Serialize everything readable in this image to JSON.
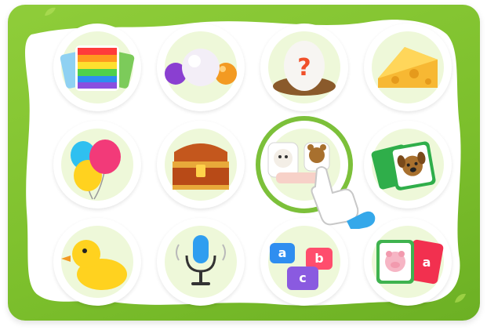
{
  "board": {
    "tiles": [
      {
        "name": "rainbow-cards-game",
        "icon": "rainbow-cards-icon"
      },
      {
        "name": "color-balls-game",
        "icon": "color-balls-icon"
      },
      {
        "name": "mystery-egg-game",
        "icon": "mystery-egg-icon",
        "label": "?"
      },
      {
        "name": "cheese-game",
        "icon": "cheese-icon"
      },
      {
        "name": "balloons-game",
        "icon": "balloons-icon"
      },
      {
        "name": "treasure-chest-game",
        "icon": "treasure-chest-icon"
      },
      {
        "name": "animal-matching-game",
        "icon": "animal-matching-icon",
        "selected": true
      },
      {
        "name": "dog-flashcards-game",
        "icon": "dog-cards-icon"
      },
      {
        "name": "rubber-duck-game",
        "icon": "rubber-duck-icon"
      },
      {
        "name": "microphone-game",
        "icon": "microphone-icon"
      },
      {
        "name": "abc-blocks-game",
        "icon": "abc-blocks-icon",
        "letters": [
          "a",
          "b",
          "c"
        ]
      },
      {
        "name": "pig-letter-cards-game",
        "icon": "pig-letter-cards-icon",
        "letters": [
          "a"
        ]
      }
    ]
  },
  "colors": {
    "frame": "#7cbf2c",
    "board": "#ffffff",
    "tile_inner": "#eef8d9",
    "selected_ring": "#7cc03a"
  }
}
